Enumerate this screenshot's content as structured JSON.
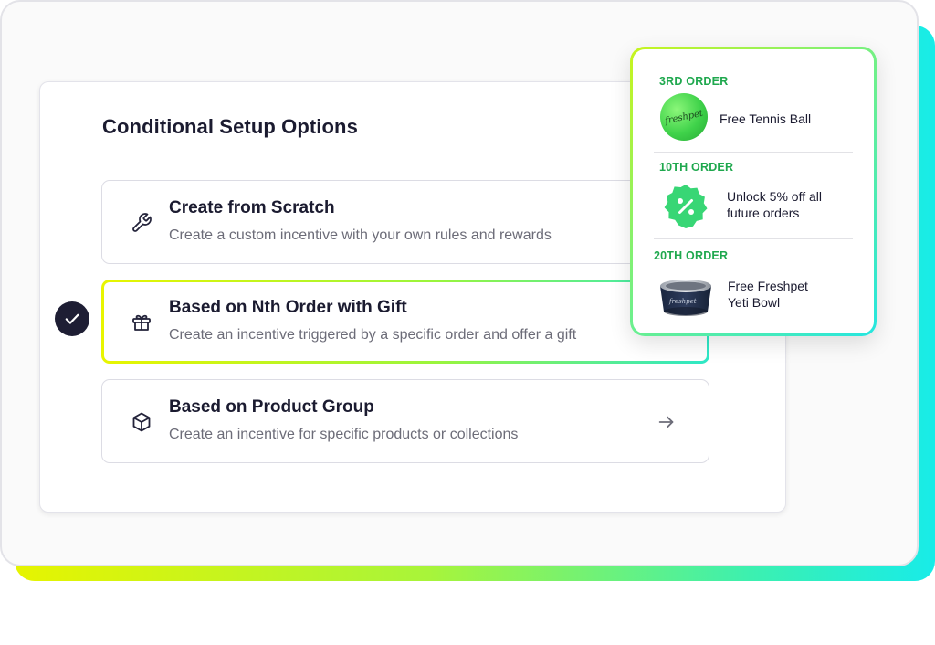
{
  "setup": {
    "title": "Conditional Setup Options",
    "options": [
      {
        "title": "Create from Scratch",
        "description": "Create a custom incentive with your own rules and rewards",
        "icon": "wrench-icon"
      },
      {
        "title": "Based on Nth Order with Gift",
        "description": "Create an incentive triggered by a specific order and offer a gift",
        "icon": "gift-icon",
        "selected": true
      },
      {
        "title": "Based on Product Group",
        "description": "Create an incentive for specific products or collections",
        "icon": "cube-icon"
      }
    ]
  },
  "rewards": [
    {
      "order": "3RD ORDER",
      "reward": "Free Tennis Ball",
      "image": "tennis-ball",
      "brand": "freshpet"
    },
    {
      "order": "10TH ORDER",
      "reward_lines": [
        "Unlock 5% off all",
        "future orders"
      ],
      "icon": "percent-badge-icon"
    },
    {
      "order": "20TH ORDER",
      "reward_lines": [
        "Free Freshpet",
        "Yeti Bowl"
      ],
      "image": "yeti-bowl",
      "brand": "freshpet"
    }
  ],
  "colors": {
    "accent_green": "#1fa84e",
    "badge_green": "#38d675",
    "check_badge": "#1e1e34",
    "gradient_start": "#e6f400",
    "gradient_end": "#18ece8"
  }
}
